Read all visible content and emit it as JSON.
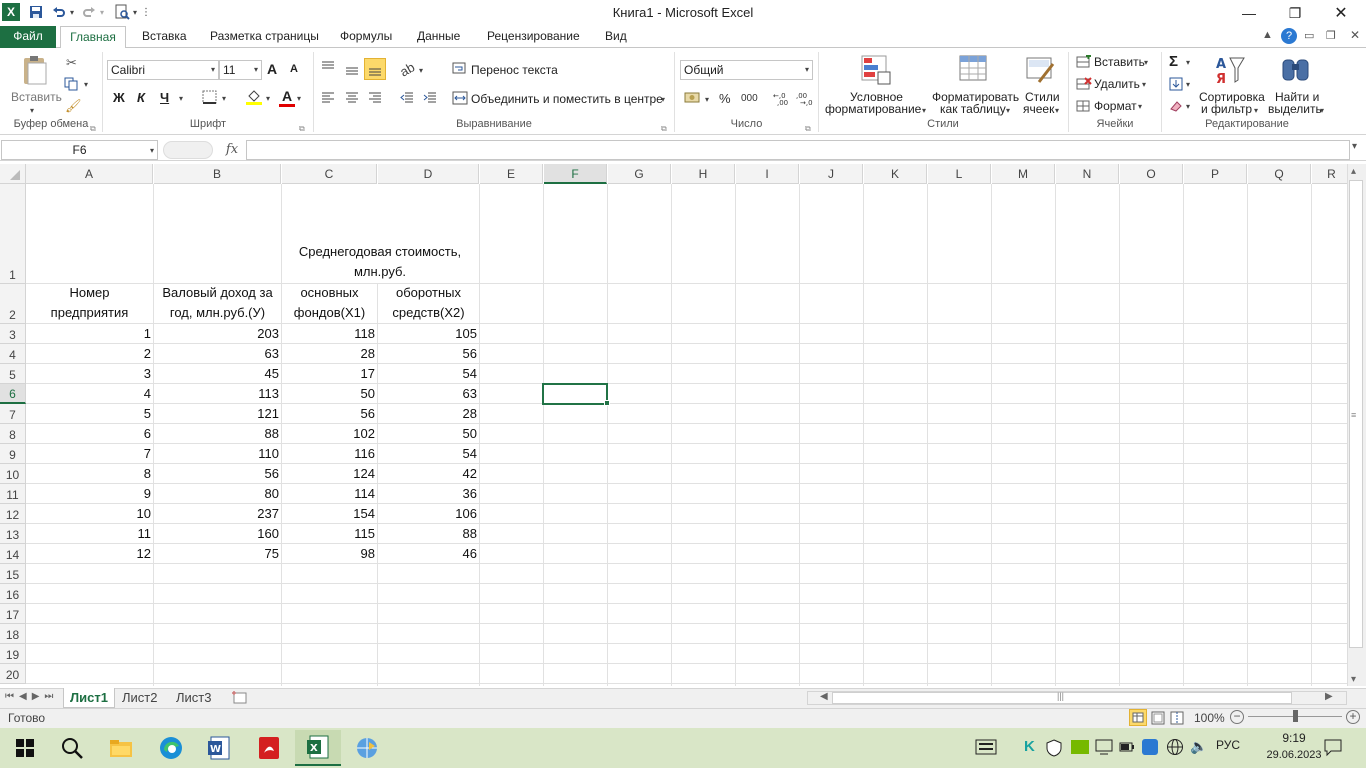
{
  "window": {
    "title": "Книга1 - Microsoft Excel"
  },
  "quick_access": {
    "save": "save-icon",
    "undo": "undo-icon",
    "redo": "redo-icon",
    "preview": "print-preview-icon"
  },
  "tabs": [
    "Файл",
    "Главная",
    "Вставка",
    "Разметка страницы",
    "Формулы",
    "Данные",
    "Рецензирование",
    "Вид"
  ],
  "ribbon": {
    "clipboard": {
      "paste": "Вставить",
      "group": "Буфер обмена"
    },
    "font": {
      "name": "Calibri",
      "size": "11",
      "bold": "Ж",
      "italic": "К",
      "underline": "Ч",
      "grow": "A",
      "shrink": "A",
      "color_letter": "A",
      "group": "Шрифт"
    },
    "alignment": {
      "wrap": "Перенос текста",
      "merge": "Объединить и поместить в центре",
      "group": "Выравнивание"
    },
    "number": {
      "format": "Общий",
      "percent": "%",
      "thousands": "000",
      "group": "Число"
    },
    "styles": {
      "conditional_1": "Условное",
      "conditional_2": "форматирование",
      "table_1": "Форматировать",
      "table_2": "как таблицу",
      "cell_1": "Стили",
      "cell_2": "ячеек",
      "group": "Стили"
    },
    "cells": {
      "insert": "Вставить",
      "delete": "Удалить",
      "format": "Формат",
      "group": "Ячейки"
    },
    "editing": {
      "sort_1": "Сортировка",
      "sort_2": "и фильтр",
      "find_1": "Найти и",
      "find_2": "выделить",
      "sigma": "Σ",
      "group": "Редактирование"
    }
  },
  "formula_bar": {
    "name_box": "F6",
    "fx": "fx",
    "content": ""
  },
  "columns": [
    "A",
    "B",
    "C",
    "D",
    "E",
    "F",
    "G",
    "H",
    "I",
    "J",
    "K",
    "L",
    "M",
    "N",
    "O",
    "P",
    "Q",
    "R"
  ],
  "rows": [
    "1",
    "2",
    "3",
    "4",
    "5",
    "6",
    "7",
    "8",
    "9",
    "10",
    "11",
    "12",
    "13",
    "14",
    "15",
    "16",
    "17",
    "18",
    "19",
    "20"
  ],
  "selected_cell": {
    "col": "F",
    "row": "6"
  },
  "sheet": {
    "header_c1_line1": "Среднегодовая стоимость,",
    "header_c1_line2": "млн.руб.",
    "a2_line1": "Номер",
    "a2_line2": "предприятия",
    "b2_line1": "Валовый доход за",
    "b2_line2": "год, млн.руб.(У)",
    "c2_line1": "основных",
    "c2_line2": "фондов(Х1)",
    "d2_line1": "оборотных",
    "d2_line2": "средств(Х2)",
    "data": [
      [
        "1",
        "203",
        "118",
        "105"
      ],
      [
        "2",
        "63",
        "28",
        "56"
      ],
      [
        "3",
        "45",
        "17",
        "54"
      ],
      [
        "4",
        "113",
        "50",
        "63"
      ],
      [
        "5",
        "121",
        "56",
        "28"
      ],
      [
        "6",
        "88",
        "102",
        "50"
      ],
      [
        "7",
        "110",
        "116",
        "54"
      ],
      [
        "8",
        "56",
        "124",
        "42"
      ],
      [
        "9",
        "80",
        "114",
        "36"
      ],
      [
        "10",
        "237",
        "154",
        "106"
      ],
      [
        "11",
        "160",
        "115",
        "88"
      ],
      [
        "12",
        "75",
        "98",
        "46"
      ]
    ]
  },
  "sheet_tabs": [
    "Лист1",
    "Лист2",
    "Лист3"
  ],
  "status": {
    "ready": "Готово",
    "zoom": "100%",
    "zoom_level": 1.0
  },
  "taskbar": {
    "lang": "РУС",
    "time": "9:19",
    "date": "29.06.2023"
  }
}
